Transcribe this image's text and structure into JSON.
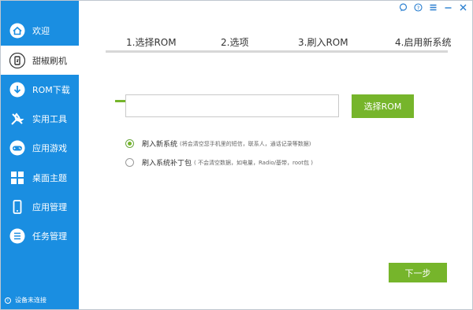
{
  "colors": {
    "sidebar": "#1a8ee1",
    "accent_green": "#76b52b",
    "step_inactive": "#d7d7d7"
  },
  "title_buttons": [
    {
      "icon": "chat-icon",
      "glyph": "◌"
    },
    {
      "icon": "help-icon",
      "glyph": "?"
    },
    {
      "icon": "menu-icon",
      "glyph": "≡"
    },
    {
      "icon": "minimize-icon",
      "glyph": "—"
    },
    {
      "icon": "close-icon",
      "glyph": "✕"
    }
  ],
  "sidebar": {
    "items": [
      {
        "label": "欢迎",
        "icon": "home-icon"
      },
      {
        "label": "甜椒刷机",
        "icon": "flash-phone-icon"
      },
      {
        "label": "ROM下载",
        "icon": "download-icon"
      },
      {
        "label": "实用工具",
        "icon": "tools-icon"
      },
      {
        "label": "应用游戏",
        "icon": "gamepad-icon"
      },
      {
        "label": "桌面主题",
        "icon": "theme-icon"
      },
      {
        "label": "应用管理",
        "icon": "phone-icon"
      },
      {
        "label": "任务管理",
        "icon": "task-list-icon"
      }
    ],
    "active_index": 1,
    "status_text": "设备未连接"
  },
  "steps": {
    "items": [
      "1.选择ROM",
      "2.选项",
      "3.刷入ROM",
      "4.启用新系统"
    ],
    "current": 1,
    "total": 4
  },
  "form": {
    "rom_path_value": "",
    "select_button": "选择ROM",
    "options": [
      {
        "label": "刷入新系统",
        "note": "(将会清空您手机里的短信，联系人，通话记录等数据)",
        "checked": true
      },
      {
        "label": "刷入系统补丁包",
        "note": "( 不会清空数据，如电量，Radio/基带，root包 )",
        "checked": false
      }
    ],
    "next_button": "下一步"
  }
}
